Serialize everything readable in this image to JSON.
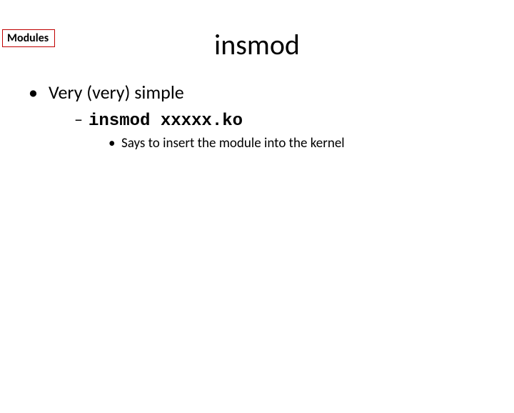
{
  "tag": "Modules",
  "title": "insmod",
  "bullet1": "Very (very) simple",
  "bullet2_code": "insmod xxxxx.ko",
  "bullet3": "Says to insert the module into the kernel"
}
